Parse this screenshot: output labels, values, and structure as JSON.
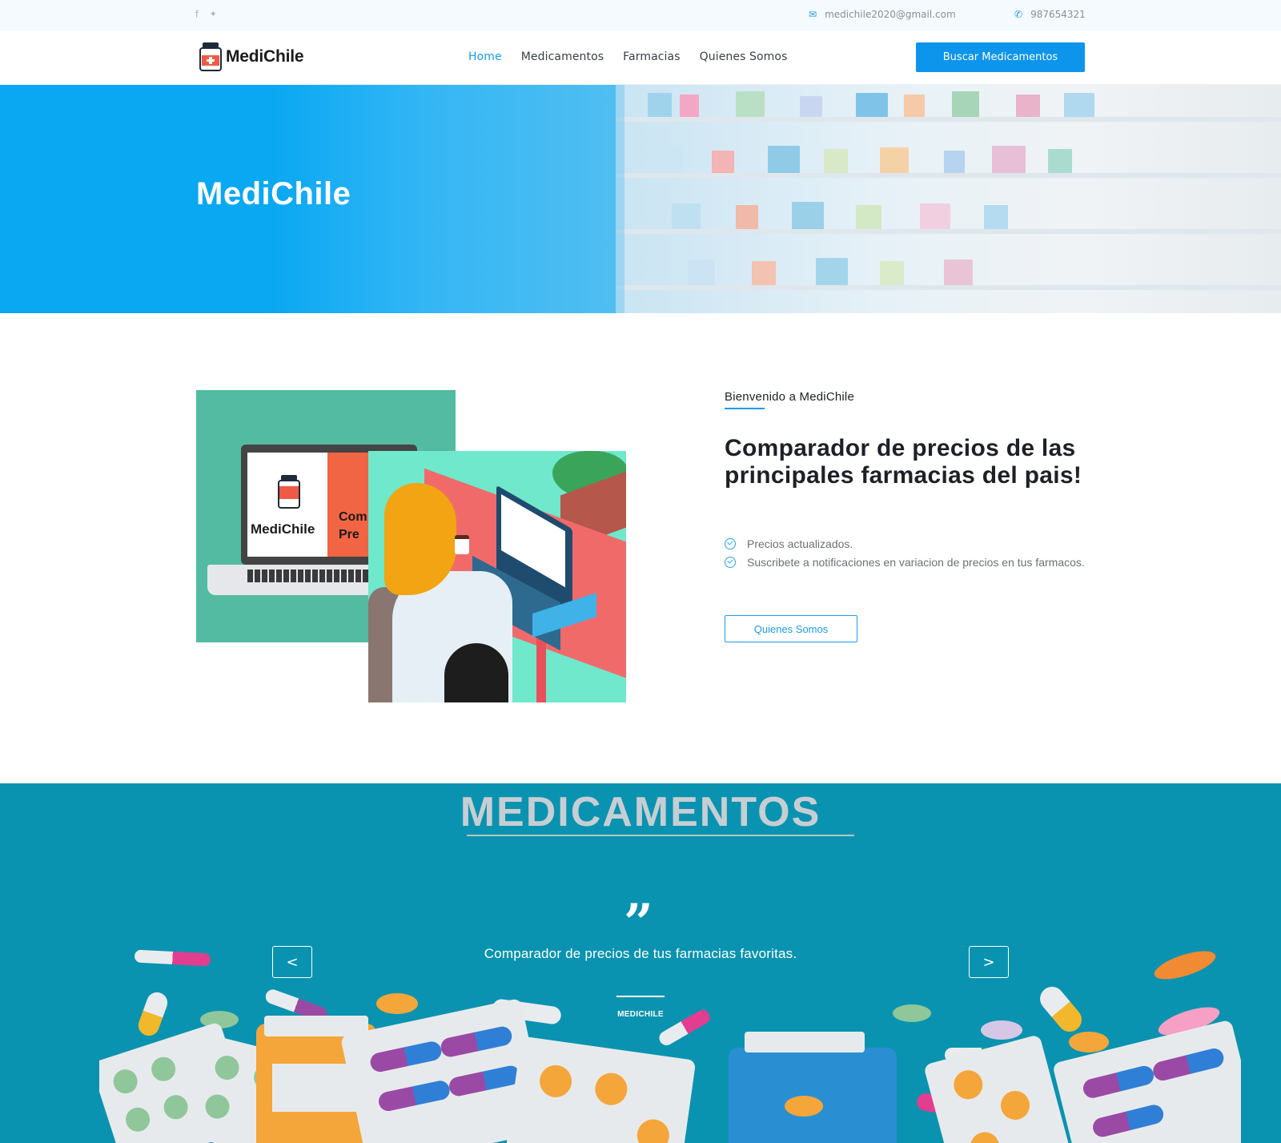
{
  "topbar": {
    "social": [
      {
        "icon": "facebook-icon",
        "glyph": "f"
      },
      {
        "icon": "twitter-icon",
        "glyph": "🐦"
      }
    ],
    "email": "medichile2020@gmail.com",
    "phone": "987654321"
  },
  "nav": {
    "logo_text": "MediChile",
    "items": [
      {
        "label": "Home",
        "active": true
      },
      {
        "label": "Medicamentos",
        "active": false
      },
      {
        "label": "Farmacias",
        "active": false
      },
      {
        "label": "Quienes Somos",
        "active": false
      }
    ],
    "cta": "Buscar Medicamentos"
  },
  "hero": {
    "title": "MediChile"
  },
  "about": {
    "illustration_brand": "MediChile",
    "illustration_text_1": "Com",
    "illustration_text_2": "Pre",
    "eyebrow": "Bienvenido a MediChile",
    "title": "Comparador de precios de las principales farmacias del pais!",
    "features": [
      "Precios actualizados.",
      "Suscribete a notificaciones en variacion de precios en tus farmacos."
    ],
    "button": "Quienes Somos"
  },
  "medicamentos": {
    "title": "MEDICAMENTOS",
    "quote_mark": "”",
    "testimonial": "Comparador de precios de tus farmacias favoritas.",
    "author": "MEDICHILE",
    "prev": "<",
    "next": ">"
  },
  "colors": {
    "accent": "#0d95ec",
    "hero_blue": "#0aa8f2",
    "meds_bg": "#0a93b0",
    "illus_green": "#52bba1",
    "illus_mint": "#6fe8cc"
  }
}
